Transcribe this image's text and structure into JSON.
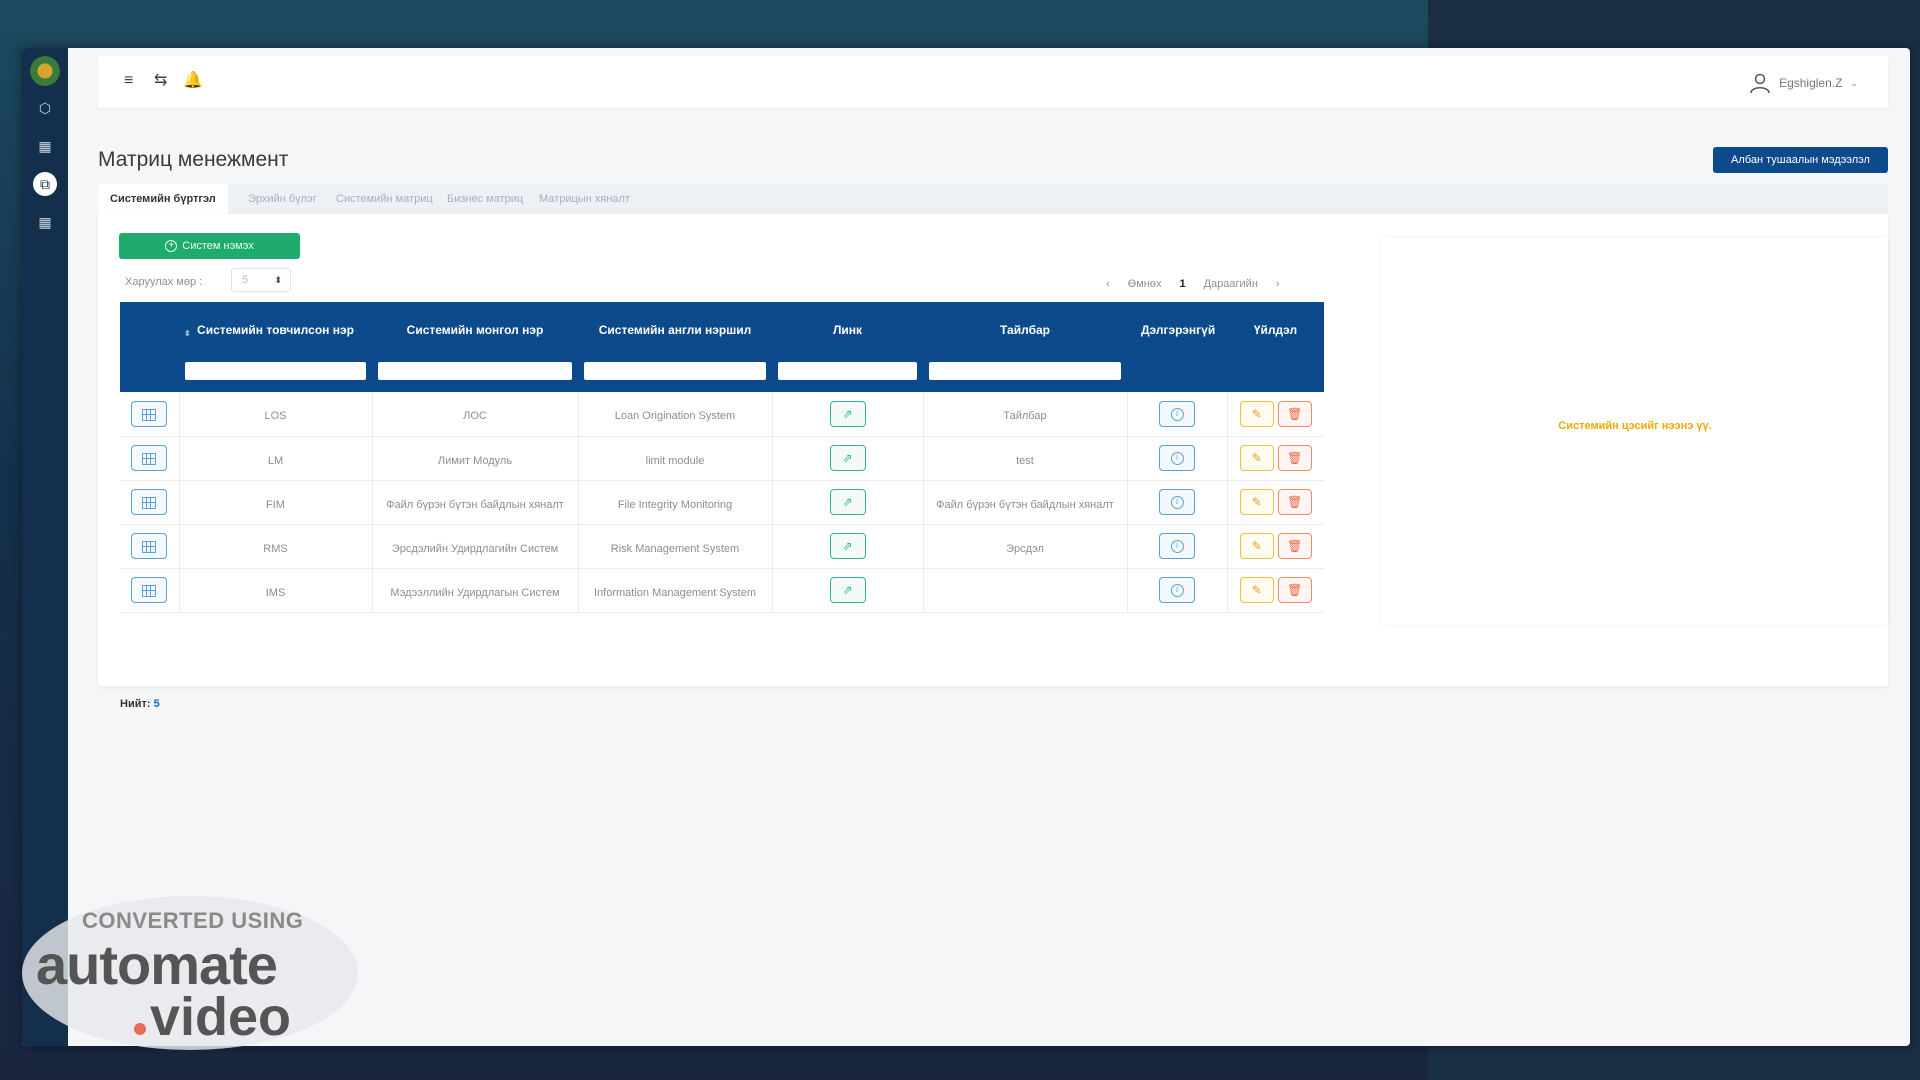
{
  "app": {
    "title": "Матриц менежмент",
    "external_button": "Албан тушаалын мэдээлэл"
  },
  "topbar": {
    "icons": [
      "menu-icon",
      "swap-icon",
      "bell-icon"
    ],
    "user_name": "Egshiglen.Z"
  },
  "tabs": [
    {
      "label": "Системийн бүртгэл",
      "active": true
    },
    {
      "label": "Эрхийн бүлэг",
      "active": false
    },
    {
      "label": "Системийн матриц",
      "active": false
    },
    {
      "label": "Бизнес матриц",
      "active": false
    },
    {
      "label": "Матрицын хяналт",
      "active": false
    }
  ],
  "toolbar": {
    "add_label": "Систем нэмэх",
    "rows_label": "Харуулах мөр :",
    "rows_value": "5"
  },
  "pager": {
    "prev_arrow": "‹",
    "prev_label": "Өмнөх",
    "current": "1",
    "next_label": "Дараагийн",
    "next_arrow": "›"
  },
  "table": {
    "columns": [
      "",
      "Системийн товчилсон нэр",
      "Системийн монгол нэр",
      "Системийн англи нэршил",
      "Линк",
      "Тайлбар",
      "Дэлгэрэнгүй",
      "Үйлдэл"
    ],
    "rows": [
      {
        "short": "LOS",
        "mn": "ЛОС",
        "en": "Loan Origination System",
        "note": "Тайлбар"
      },
      {
        "short": "LM",
        "mn": "Лимит Модуль",
        "en": "limit module",
        "note": "test"
      },
      {
        "short": "FIM",
        "mn": "Файл бүрэн бүтэн байдлын хяналт",
        "en": "File Integrity Monitoring",
        "note": "Файл бүрэн бүтэн байдлын хяналт"
      },
      {
        "short": "RMS",
        "mn": "Эрсдэлийн Удирдлагийн Систем",
        "en": "Risk Management System",
        "note": "Эрсдэл"
      },
      {
        "short": "IMS",
        "mn": "Мэдээллийн Удирдлагын Систем",
        "en": "Information Management System",
        "note": ""
      }
    ]
  },
  "total": {
    "label": "Нийт:",
    "value": "5"
  },
  "detail": {
    "hint": "Системийн цэсийг нээнэ үү."
  },
  "watermark": {
    "line1": "CONVERTED USING",
    "line2": "automate",
    "line3": "video",
    "dot_color": "#e86a5a"
  },
  "colors": {
    "primary": "#0d4a8c",
    "success": "#1fab6b",
    "warning": "#f0a800",
    "rail": "#142f4c"
  }
}
